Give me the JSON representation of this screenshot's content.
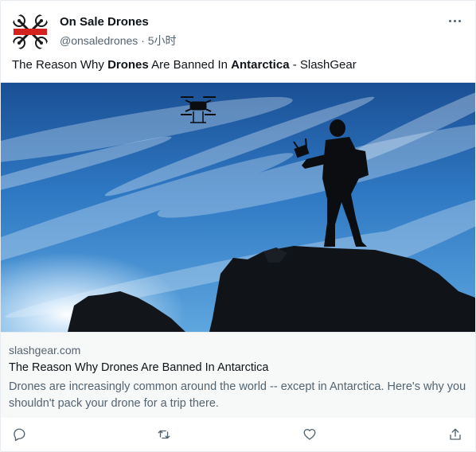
{
  "author": {
    "display_name": "On Sale Drones",
    "handle": "@onsaledrones",
    "separator": "·",
    "time": "5小时",
    "avatar_text": "On Sale Drones"
  },
  "tweet": {
    "text_parts": [
      "The Reason Why ",
      "Drones",
      " Are Banned In ",
      "Antarctica",
      " - SlashGear"
    ]
  },
  "card": {
    "domain": "slashgear.com",
    "title": "The Reason Why Drones Are Banned In Antarctica",
    "description": "Drones are increasingly common around the world -- except in Antarctica. Here's why you shouldn't pack your drone for a trip there."
  },
  "actions": {
    "reply_icon": "reply-icon",
    "retweet_icon": "retweet-icon",
    "like_icon": "heart-icon",
    "share_icon": "share-icon"
  },
  "colors": {
    "secondary_text": "#536471",
    "card_bg": "#f7f9f9",
    "avatar_red": "#d4231e"
  }
}
